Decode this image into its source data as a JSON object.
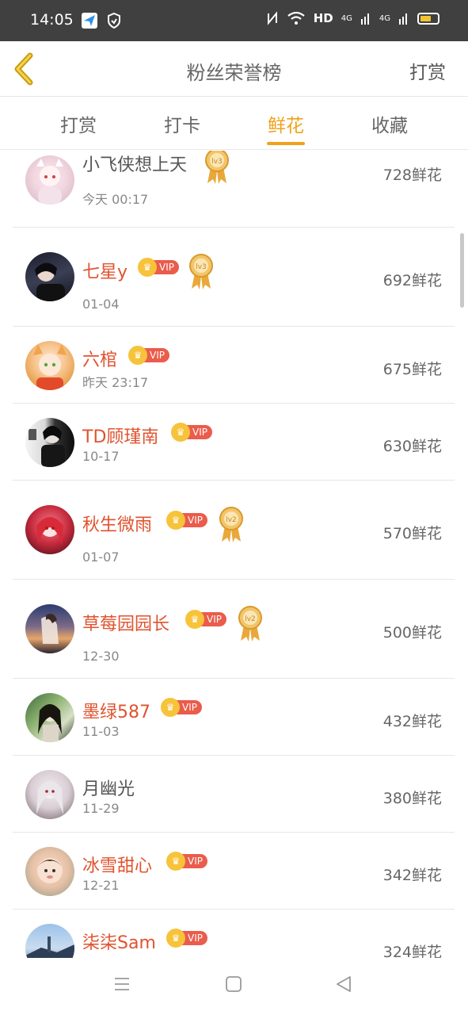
{
  "status_bar": {
    "time": "14:05",
    "hd_label": "HD",
    "net_label_1": "4G",
    "net_label_2": "4G"
  },
  "nav": {
    "title": "粉丝荣誉榜",
    "right_action": "打赏"
  },
  "tabs": [
    {
      "label": "打赏",
      "active": false
    },
    {
      "label": "打卡",
      "active": false
    },
    {
      "label": "鲜花",
      "active": true
    },
    {
      "label": "收藏",
      "active": false
    }
  ],
  "vip_label": "VIP",
  "rows": [
    {
      "name": "小飞侠想上天",
      "vip": false,
      "medal": "lv3",
      "time": "今天 00:17",
      "count": "728鲜花"
    },
    {
      "name": "七星y",
      "vip": true,
      "medal": "lv3",
      "time": "01-04",
      "count": "692鲜花"
    },
    {
      "name": "六棺",
      "vip": true,
      "medal": "",
      "time": "昨天 23:17",
      "count": "675鲜花"
    },
    {
      "name": "TD顾瑾南",
      "vip": true,
      "medal": "",
      "time": "10-17",
      "count": "630鲜花"
    },
    {
      "name": "秋生微雨",
      "vip": true,
      "medal": "lv2",
      "time": "01-07",
      "count": "570鲜花"
    },
    {
      "name": "草莓园园长",
      "vip": true,
      "medal": "lv2",
      "time": "12-30",
      "count": "500鲜花"
    },
    {
      "name": "墨绿587",
      "vip": true,
      "medal": "",
      "time": "11-03",
      "count": "432鲜花"
    },
    {
      "name": "月幽光",
      "vip": false,
      "medal": "",
      "time": "11-29",
      "count": "380鲜花"
    },
    {
      "name": "冰雪甜心",
      "vip": true,
      "medal": "",
      "time": "12-21",
      "count": "342鲜花"
    },
    {
      "name": "柒柒Sam",
      "vip": true,
      "medal": "",
      "time": "",
      "count": "324鲜花"
    }
  ],
  "colors": {
    "accent": "#f0a21c",
    "vip_name": "#e0532f",
    "vip_badge": "#ea5c4b",
    "crown": "#f6c33a"
  }
}
